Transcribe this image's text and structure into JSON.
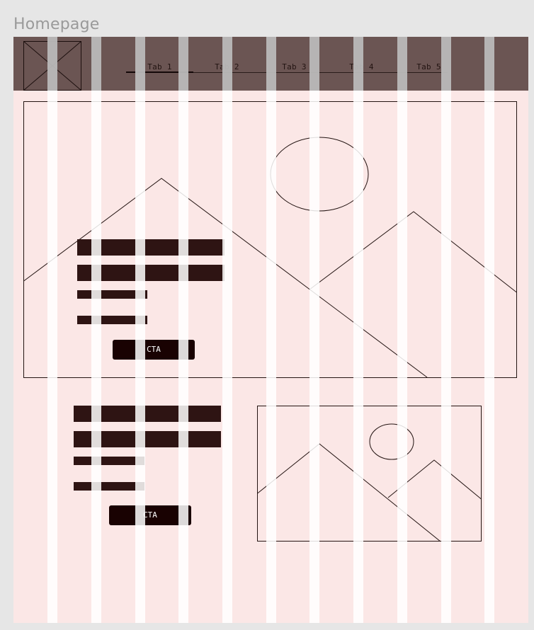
{
  "frame": {
    "title": "Homepage"
  },
  "header": {
    "tabs": [
      {
        "label": "Tab 1",
        "active": true
      },
      {
        "label": "Tab 2",
        "active": false
      },
      {
        "label": "Tab 3",
        "active": false
      },
      {
        "label": "Tab 4",
        "active": false
      },
      {
        "label": "Tab 5",
        "active": false
      }
    ],
    "logo_icon": "image-placeholder-icon"
  },
  "hero": {
    "image_icon": "landscape-placeholder-icon",
    "cta_label": "CTA"
  },
  "feature": {
    "image_icon": "landscape-placeholder-icon",
    "cta_label": "CTA"
  },
  "colors": {
    "canvas": "#e6e6e6",
    "artboard": "#fbe7e6",
    "header": "#6b5553",
    "text_block": "#2e1413",
    "cta": "#190202"
  }
}
